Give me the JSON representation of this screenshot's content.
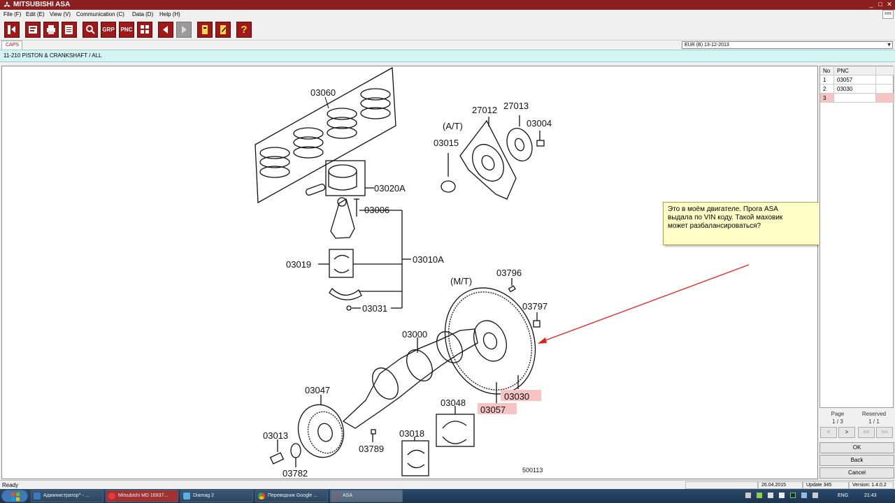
{
  "window": {
    "title": "MITSUBISHI ASA",
    "controls": [
      "_",
      "□",
      "✕"
    ],
    "corner_logo": "XXX"
  },
  "menu": [
    "File (F)",
    "Edit (E)",
    "View (V)",
    "Communication (C)",
    "Data (D)",
    "Help (H)"
  ],
  "toolbar": {
    "grp_label": "GRP",
    "pnc_label": "PNC",
    "help_label": "?"
  },
  "tabs": {
    "caps": "CAPS"
  },
  "region": {
    "value": "EUR (B)   13-12-2013"
  },
  "path": "11-210  PISTON & CRANKSHAFT / ALL",
  "diagram": {
    "labels": {
      "p03060": "03060",
      "p03020A": "03020A",
      "p03006": "03006",
      "p03010A": "03010A",
      "p03019": "03019",
      "p03031": "03031",
      "p27012": "27012",
      "p27013": "27013",
      "p03004": "03004",
      "p03015": "03015",
      "at": "(A/T)",
      "mt": "(M/T)",
      "p03796": "03796",
      "p03797": "03797",
      "p03000": "03000",
      "p03030": "03030",
      "p03057": "03057",
      "p03047": "03047",
      "p03048": "03048",
      "p03013": "03013",
      "p03018": "03018",
      "p03789": "03789",
      "p03782": "03782",
      "code": "500113"
    },
    "highlight_color": "#f8c3c3",
    "arrow_color": "#e02020"
  },
  "callout": {
    "text": "Это в моём двигателе. Прога ASA\nвыдала по VIN коду. Такой маховик\nможет разбалансироваться?"
  },
  "pnc_table": {
    "headers": [
      "No",
      "PNC"
    ],
    "rows": [
      {
        "no": "1",
        "pnc": "03057"
      },
      {
        "no": "2",
        "pnc": "03030"
      },
      {
        "no": "3",
        "pnc": ""
      }
    ]
  },
  "paging": {
    "page_label": "Page",
    "page_value": "1 / 3",
    "reserved_label": "Reserved",
    "reserved_value": "1 / 1",
    "nav": [
      "<",
      ">",
      "<<",
      ">>"
    ]
  },
  "buttons": {
    "ok": "OK",
    "back": "Back",
    "cancel": "Cancel"
  },
  "status": {
    "ready": "Ready",
    "date": "26.04.2015",
    "update": "Update 345",
    "version": "Version: 1.4.0.2"
  },
  "taskbar": {
    "tasks": [
      "Администратор^ - ...",
      "Mitsubishi MD 16937...",
      "Diamag 2",
      "Переводчик Google ...",
      "ASA"
    ],
    "lang": "ENG",
    "time": "21:43"
  }
}
